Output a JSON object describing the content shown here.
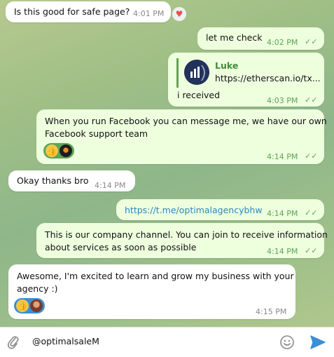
{
  "messages": [
    {
      "text": "Is this good for safe page?",
      "time": "4:01 PM",
      "reaction": "heart-icon"
    },
    {
      "text": "let me check",
      "time": "4:02 PM"
    },
    {
      "reply_name": "Luke",
      "reply_text": "https://etherscan.io/tx...",
      "text": "i received",
      "time": "4:03 PM"
    },
    {
      "text_line1": "When you run Facebook you can message me, we have our own",
      "text_line2": "Facebook support team",
      "time": "4:14 PM"
    },
    {
      "text": "Okay thanks bro",
      "time": "4:14 PM"
    },
    {
      "text": "https://t.me/optimalagencybhw",
      "time": "4:14 PM"
    },
    {
      "text_line1": "This is our company channel. You can join to receive information",
      "text_line2": "about services as soon as possible",
      "time": "4:14 PM"
    },
    {
      "text_line1": "Awesome, I'm excited to learn and grow my business with your",
      "text_line2": "agency :)",
      "time": "4:15 PM"
    }
  ],
  "composer": {
    "value": "@optimalsaleM"
  },
  "colors": {
    "outgoing": "#eeffde",
    "incoming": "#ffffff",
    "accent": "#5fa357",
    "link": "#2e86c1",
    "send": "#3b8fd4"
  },
  "icons": {
    "attach": "paperclip-icon",
    "emoji": "smiley-icon",
    "send": "send-icon",
    "read": "double-check-icon"
  }
}
